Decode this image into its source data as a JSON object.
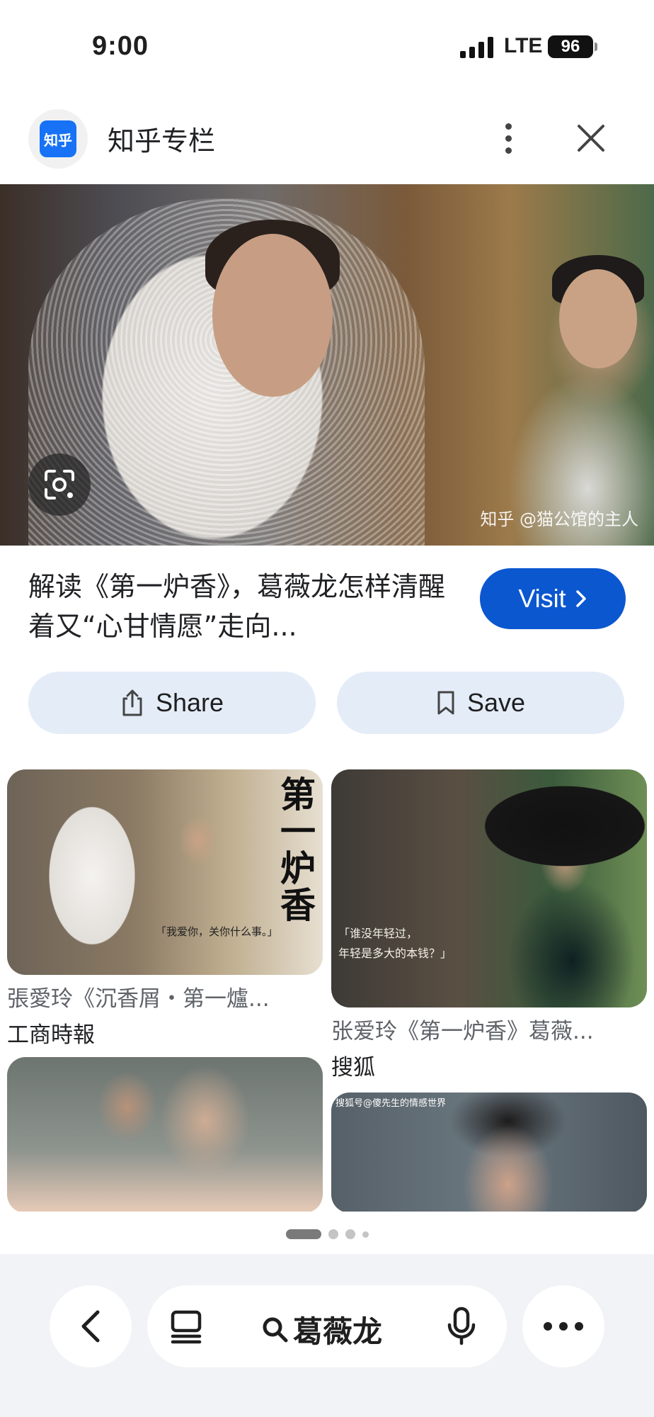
{
  "status_bar": {
    "time": "9:00",
    "network": "LTE",
    "battery": "96"
  },
  "source": {
    "favicon_text": "知乎",
    "name": "知乎专栏"
  },
  "hero": {
    "watermark": "知乎 @猫公馆的主人"
  },
  "result": {
    "title": "解读《第一炉香》，葛薇龙怎样清醒着又“心甘情愿”走向...",
    "visit_label": "Visit"
  },
  "actions": {
    "share_label": "Share",
    "save_label": "Save"
  },
  "related": [
    {
      "caption": "張愛玲《沉香屑・第一爐...",
      "source": "工商時報",
      "poster_text": "第一炉香",
      "quote": "「我爱你，关你什么事。」"
    },
    {
      "caption": "张爱玲《第一炉香》葛薇...",
      "source": "搜狐",
      "quote": "「谁没年轻过，\n年轻是多大的本钱？」"
    },
    {
      "caption": "",
      "source": ""
    },
    {
      "caption": "",
      "source": "",
      "mark": "搜狐号@傻先生的情感世界"
    }
  ],
  "pager": {
    "pages": 4,
    "active": 1
  },
  "bottom_bar": {
    "search_query": "葛薇龙"
  },
  "colors": {
    "accent": "#0b57d0",
    "pill_bg": "#e4ecf8",
    "favicon_bg": "#1772f6"
  }
}
